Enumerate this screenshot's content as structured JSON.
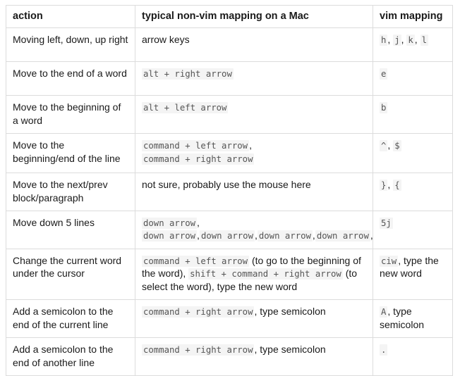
{
  "table": {
    "name": "vim-vs-mac-keyboard-mapping-table",
    "columns": [
      {
        "key": "action",
        "label": "action"
      },
      {
        "key": "mapping",
        "label": "typical non-vim mapping on a Mac"
      },
      {
        "key": "vim",
        "label": "vim mapping"
      }
    ],
    "rows": [
      {
        "action": "Moving left, down, up right",
        "mapping_parts": [
          {
            "type": "plain",
            "text": "arrow keys"
          }
        ],
        "vim_parts": [
          {
            "type": "code",
            "text": "h"
          },
          {
            "type": "plain",
            "text": ", "
          },
          {
            "type": "code",
            "text": "j"
          },
          {
            "type": "plain",
            "text": ", "
          },
          {
            "type": "code",
            "text": "k"
          },
          {
            "type": "plain",
            "text": ", "
          },
          {
            "type": "code",
            "text": "l"
          }
        ]
      },
      {
        "action": "Move to the end of a word",
        "mapping_parts": [
          {
            "type": "code",
            "text": "alt + right arrow"
          }
        ],
        "vim_parts": [
          {
            "type": "code",
            "text": "e"
          }
        ]
      },
      {
        "action": "Move to the beginning of a word",
        "mapping_parts": [
          {
            "type": "code",
            "text": "alt + left arrow"
          }
        ],
        "vim_parts": [
          {
            "type": "code",
            "text": "b"
          }
        ]
      },
      {
        "action": "Move to the beginning/end of the line",
        "mapping_parts": [
          {
            "type": "code",
            "text": "command + left arrow"
          },
          {
            "type": "plain",
            "text": ", "
          },
          {
            "type": "code",
            "text": "command + right arrow"
          }
        ],
        "vim_parts": [
          {
            "type": "code",
            "text": "^"
          },
          {
            "type": "plain",
            "text": ", "
          },
          {
            "type": "code",
            "text": "$"
          }
        ]
      },
      {
        "action": "Move to the next/prev block/paragraph",
        "mapping_parts": [
          {
            "type": "plain",
            "text": "not sure, probably use the mouse here"
          }
        ],
        "vim_parts": [
          {
            "type": "code",
            "text": "}"
          },
          {
            "type": "plain",
            "text": ", "
          },
          {
            "type": "code",
            "text": "{"
          }
        ]
      },
      {
        "action": "Move down 5 lines",
        "mapping_parts": [
          {
            "type": "code",
            "text": "down arrow"
          },
          {
            "type": "plain",
            "text": ", "
          },
          {
            "type": "code",
            "text": "down arrow"
          },
          {
            "type": "plain",
            "text": ","
          },
          {
            "type": "code",
            "text": "down arrow"
          },
          {
            "type": "plain",
            "text": ","
          },
          {
            "type": "code",
            "text": "down arrow"
          },
          {
            "type": "plain",
            "text": ","
          },
          {
            "type": "code",
            "text": "down arrow"
          },
          {
            "type": "plain",
            "text": ","
          }
        ],
        "vim_parts": [
          {
            "type": "code",
            "text": "5j"
          }
        ]
      },
      {
        "action": "Change the current word under the cursor",
        "mapping_parts": [
          {
            "type": "code",
            "text": "command + left arrow"
          },
          {
            "type": "plain",
            "text": " (to go to the beginning of the word), "
          },
          {
            "type": "code",
            "text": "shift + command + right arrow"
          },
          {
            "type": "plain",
            "text": " (to select the word), type the new word"
          }
        ],
        "vim_parts": [
          {
            "type": "code",
            "text": "ciw"
          },
          {
            "type": "plain",
            "text": ", type the new word"
          }
        ]
      },
      {
        "action": "Add a semicolon to the end of the current line",
        "mapping_parts": [
          {
            "type": "code",
            "text": "command + right arrow"
          },
          {
            "type": "plain",
            "text": ", type semicolon"
          }
        ],
        "vim_parts": [
          {
            "type": "code",
            "text": "A"
          },
          {
            "type": "plain",
            "text": ", type semicolon"
          }
        ]
      },
      {
        "action": "Add a semicolon to the end of another line",
        "mapping_parts": [
          {
            "type": "code",
            "text": "command + right arrow"
          },
          {
            "type": "plain",
            "text": ", type semicolon"
          }
        ],
        "vim_parts": [
          {
            "type": "code",
            "text": "."
          }
        ]
      }
    ]
  },
  "colors": {
    "border": "#dcdcdc",
    "code_background": "#f4f4f4",
    "code_text": "#555555",
    "text": "#1a1a1a",
    "page_background": "#ffffff"
  }
}
